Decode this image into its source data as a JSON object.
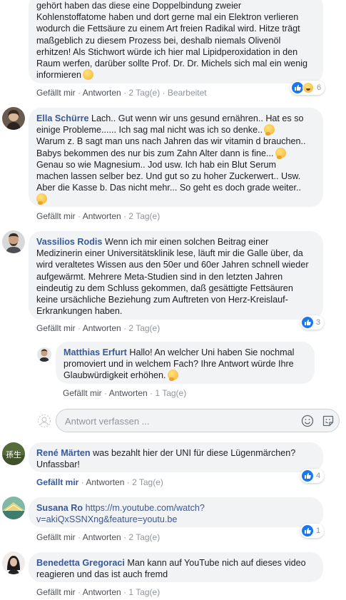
{
  "actions": {
    "like": "Gefällt mir",
    "reply": "Antworten",
    "sep": "·",
    "edited": "Bearbeitet"
  },
  "reply_box": {
    "placeholder": "Antwort verfassen ..."
  },
  "comments": [
    {
      "text_lines": [
        "gehört haben das diese eine Doppelbindung zweier",
        "Kohlenstoffatome haben und dort gerne mal ein Elektron verlieren",
        "wodurch die Fettsäure zu einem Art freien Radikal wird. Hitze trägt",
        "maßgeblich zu diesem Prozess bei, deshalb niemals Olivenöl",
        "erhitzen! Als Stichwort würde ich hier mal Lipidperoxidation in den",
        "Raum werfen, darüber sollte Prof. Dr. Dr. Michels sich mal ein wenig",
        "informieren"
      ],
      "time": "2 Tag(e)",
      "reaction_count": "6"
    },
    {
      "author": "Ella Schürre",
      "text_lines": [
        "Lach.. Gut wenn wir uns gesund ernähren.. Hat es so",
        "einige Probleme...... Ich sag mal nicht was ich so denke..",
        "Warum z. B sagt man uns nach Jahren das wir vitamin d brauchen..",
        "Babys bekommen des nur bis zum Zahn Alter dann is fine...",
        "Genau so wie Magnesium.. Jod usw. Ich hab ein Blut Serum",
        "machen lassen selber bez. Und gut so zu hoher Zuckerwert.. Usw.",
        "Aber die Kasse b. Das nicht mehr... So geht es doch grade weiter..",
        ""
      ],
      "time": "2 Tag(e)"
    },
    {
      "author": "Vassilios Rodis",
      "text_lines": [
        "Wenn ich mir einen solchen Beitrag einer",
        "Medizinerin einer Universitätsklinik lese, läuft mir die Galle über, da",
        "wird veraltetes Wissen aus den 50er und 60er Jahren schnell wieder",
        "aufgewärmt. Mehrere Meta-Studien sind in den letzten Jahren",
        "eindeutig zu dem Schluss gekommen, daß gesättigte Fettsäuren",
        "keine ursächliche Beziehung zum Auftreten von Herz-Kreislauf-",
        "Erkrankungen haben."
      ],
      "time": "2 Tag(e)",
      "reaction_count": "3"
    },
    {
      "author": "Matthias Erfurt",
      "text_lines": [
        "Hallo! An welcher Uni haben Sie nochmal",
        "promoviert und in welchem Fach? Ihre Antwort würde Ihre",
        "Glaubwürdigkeit erhöhen."
      ],
      "time": "1 Tag(e)"
    },
    {
      "author": "René Märten",
      "text_lines": [
        "was bezahlt hier der UNI für diese Lügenmärchen?",
        "Unfassbar!"
      ],
      "time": "2 Tag(e)",
      "reaction_count": "4"
    },
    {
      "author": "Susana Ro",
      "text_lines": [
        "https://m.youtube.com/watch?",
        "v=akiQxSSNXng&feature=youtu.be"
      ],
      "time": "2 Tag(e)",
      "reaction_count": "1"
    },
    {
      "author": "Benedetta Gregoraci",
      "text_lines": [
        "Man kann auf YouTube nich auf dieses video",
        "reagieren und das ist auch fremd"
      ],
      "time": "1 Tag(e)"
    }
  ]
}
